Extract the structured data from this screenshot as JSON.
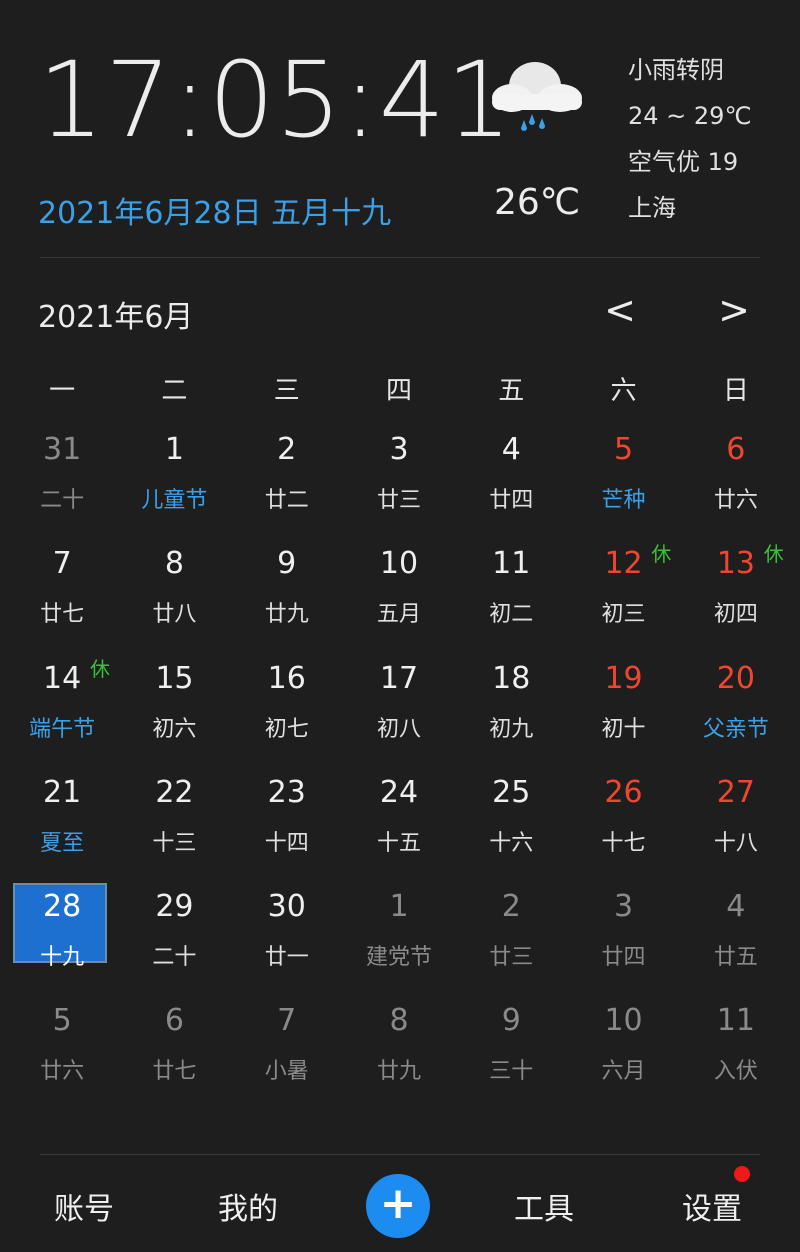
{
  "clock": {
    "time": "17:05:41",
    "date": "2021年6月28日 五月十九"
  },
  "weather": {
    "icon": "rain-cloud-icon",
    "current_temp": "26℃",
    "condition": "小雨转阴",
    "range": "24 ~ 29℃",
    "air": "空气优 19",
    "city": "上海"
  },
  "calendar": {
    "month_title": "2021年6月",
    "prev_label": "<",
    "next_label": ">",
    "weekdays": [
      "一",
      "二",
      "三",
      "四",
      "五",
      "六",
      "日"
    ],
    "rest_label": "休",
    "rows": [
      [
        {
          "d": "31",
          "l": "二十",
          "other": true
        },
        {
          "d": "1",
          "l": "儿童节",
          "fest": true
        },
        {
          "d": "2",
          "l": "廿二"
        },
        {
          "d": "3",
          "l": "廿三"
        },
        {
          "d": "4",
          "l": "廿四"
        },
        {
          "d": "5",
          "l": "芒种",
          "fest": true,
          "red": true
        },
        {
          "d": "6",
          "l": "廿六",
          "red": true
        }
      ],
      [
        {
          "d": "7",
          "l": "廿七"
        },
        {
          "d": "8",
          "l": "廿八"
        },
        {
          "d": "9",
          "l": "廿九"
        },
        {
          "d": "10",
          "l": "五月"
        },
        {
          "d": "11",
          "l": "初二"
        },
        {
          "d": "12",
          "l": "初三",
          "red": true,
          "rest": true
        },
        {
          "d": "13",
          "l": "初四",
          "red": true,
          "rest": true
        }
      ],
      [
        {
          "d": "14",
          "l": "端午节",
          "fest": true,
          "rest": true
        },
        {
          "d": "15",
          "l": "初六"
        },
        {
          "d": "16",
          "l": "初七"
        },
        {
          "d": "17",
          "l": "初八"
        },
        {
          "d": "18",
          "l": "初九"
        },
        {
          "d": "19",
          "l": "初十",
          "red": true
        },
        {
          "d": "20",
          "l": "父亲节",
          "fest": true,
          "red": true
        }
      ],
      [
        {
          "d": "21",
          "l": "夏至",
          "fest": true
        },
        {
          "d": "22",
          "l": "十三"
        },
        {
          "d": "23",
          "l": "十四"
        },
        {
          "d": "24",
          "l": "十五"
        },
        {
          "d": "25",
          "l": "十六"
        },
        {
          "d": "26",
          "l": "十七",
          "red": true
        },
        {
          "d": "27",
          "l": "十八",
          "red": true
        }
      ],
      [
        {
          "d": "28",
          "l": "十九",
          "selected": true
        },
        {
          "d": "29",
          "l": "二十"
        },
        {
          "d": "30",
          "l": "廿一"
        },
        {
          "d": "1",
          "l": "建党节",
          "other": true
        },
        {
          "d": "2",
          "l": "廿三",
          "other": true
        },
        {
          "d": "3",
          "l": "廿四",
          "other": true
        },
        {
          "d": "4",
          "l": "廿五",
          "other": true
        }
      ],
      [
        {
          "d": "5",
          "l": "廿六",
          "other": true
        },
        {
          "d": "6",
          "l": "廿七",
          "other": true
        },
        {
          "d": "7",
          "l": "小暑",
          "other": true
        },
        {
          "d": "8",
          "l": "廿九",
          "other": true
        },
        {
          "d": "9",
          "l": "三十",
          "other": true
        },
        {
          "d": "10",
          "l": "六月",
          "other": true
        },
        {
          "d": "11",
          "l": "入伏",
          "other": true
        }
      ]
    ]
  },
  "bottom": {
    "account": "账号",
    "mine": "我的",
    "add": "+",
    "tools": "工具",
    "settings": "设置"
  },
  "colors": {
    "accent": "#1d8cf0",
    "festival": "#3aa0e8",
    "weekend": "#f0462f",
    "rest": "#3cc03c"
  }
}
